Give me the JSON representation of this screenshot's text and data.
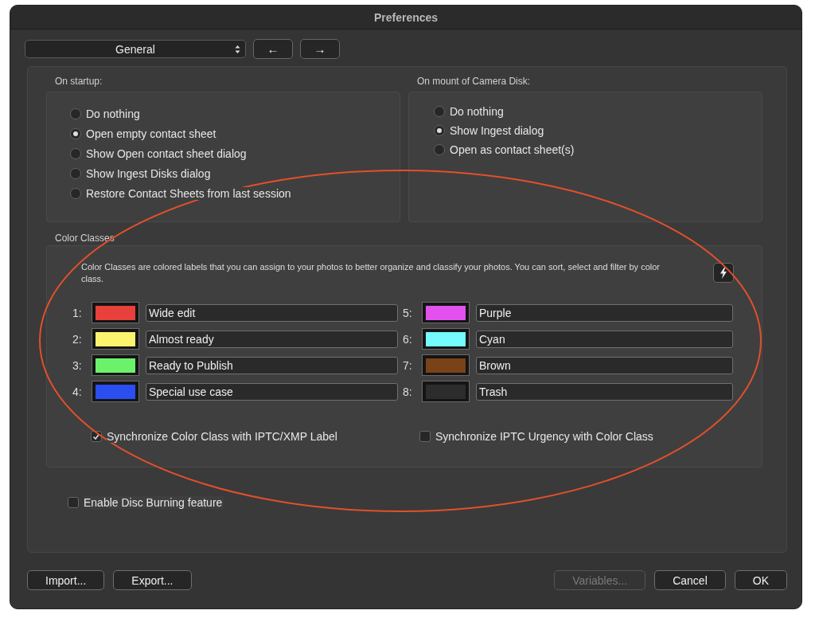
{
  "window": {
    "title": "Preferences"
  },
  "toolbar": {
    "section_select": {
      "value": "General"
    },
    "back_button": "←",
    "forward_button": "→"
  },
  "startup": {
    "label": "On startup:",
    "options": [
      {
        "label": "Do nothing",
        "selected": false
      },
      {
        "label": "Open empty contact sheet",
        "selected": true
      },
      {
        "label": "Show Open contact sheet dialog",
        "selected": false
      },
      {
        "label": "Show Ingest Disks dialog",
        "selected": false
      },
      {
        "label": "Restore Contact Sheets from last session",
        "selected": false
      }
    ]
  },
  "camera_mount": {
    "label": "On mount of Camera Disk:",
    "options": [
      {
        "label": "Do nothing",
        "selected": false
      },
      {
        "label": "Show Ingest dialog",
        "selected": true
      },
      {
        "label": "Open as contact sheet(s)",
        "selected": false
      }
    ]
  },
  "color_classes": {
    "label": "Color Classes",
    "description": "Color Classes are colored labels that you can assign to your photos to better organize and classify your photos.  You can sort, select and filter by color class.",
    "rows": [
      {
        "number": "1:",
        "color": "#e8403a",
        "name": "Wide edit"
      },
      {
        "number": "2:",
        "color": "#fbf36e",
        "name": "Almost ready"
      },
      {
        "number": "3:",
        "color": "#6cf26a",
        "name": "Ready to Publish"
      },
      {
        "number": "4:",
        "color": "#2a4ef0",
        "name": "Special use case"
      },
      {
        "number": "5:",
        "color": "#e251ee",
        "name": "Purple"
      },
      {
        "number": "6:",
        "color": "#73fbfd",
        "name": "Cyan"
      },
      {
        "number": "7:",
        "color": "#7a4217",
        "name": "Brown"
      },
      {
        "number": "8:",
        "color": "#2c2c2c",
        "name": "Trash"
      }
    ],
    "sync_options": [
      {
        "label": "Synchronize Color Class with IPTC/XMP Label",
        "checked": true
      },
      {
        "label": "Synchronize IPTC Urgency with Color Class",
        "checked": false
      }
    ]
  },
  "disc_burning": {
    "label": "Enable Disc Burning feature",
    "checked": false
  },
  "left_buttons": [
    {
      "label": "Import...",
      "disabled": false
    },
    {
      "label": "Export...",
      "disabled": false
    }
  ],
  "right_buttons": [
    {
      "label": "Variables...",
      "disabled": true
    },
    {
      "label": "Cancel",
      "disabled": false
    },
    {
      "label": "OK",
      "disabled": false
    }
  ]
}
